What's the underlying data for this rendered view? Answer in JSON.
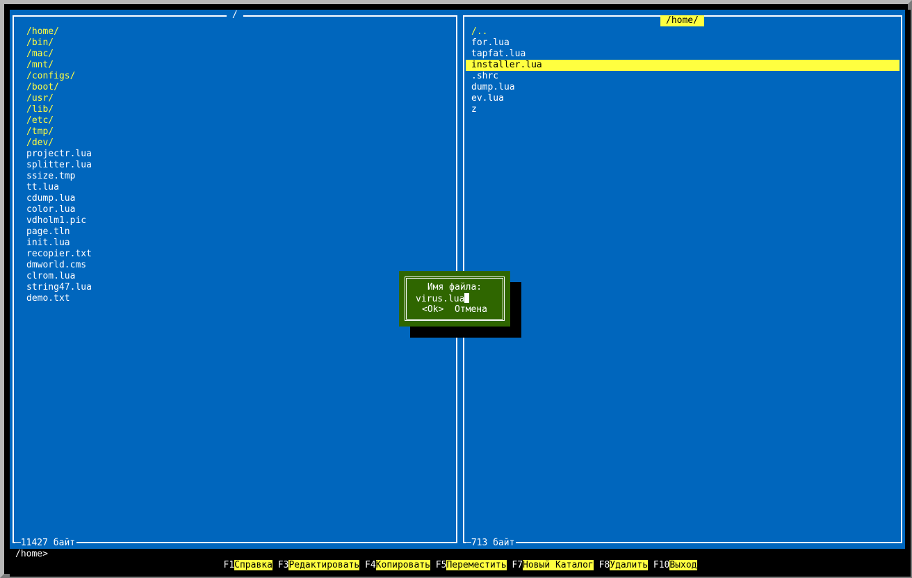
{
  "left_panel": {
    "title": "/",
    "items": [
      {
        "name": "/home/",
        "type": "dir"
      },
      {
        "name": "/bin/",
        "type": "dir"
      },
      {
        "name": "/mac/",
        "type": "dir"
      },
      {
        "name": "/mnt/",
        "type": "dir"
      },
      {
        "name": "/configs/",
        "type": "dir"
      },
      {
        "name": "/boot/",
        "type": "dir"
      },
      {
        "name": "/usr/",
        "type": "dir"
      },
      {
        "name": "/lib/",
        "type": "dir"
      },
      {
        "name": "/etc/",
        "type": "dir"
      },
      {
        "name": "/tmp/",
        "type": "dir"
      },
      {
        "name": "/dev/",
        "type": "dir"
      },
      {
        "name": "projectr.lua",
        "type": "file"
      },
      {
        "name": "splitter.lua",
        "type": "file"
      },
      {
        "name": "ssize.tmp",
        "type": "file"
      },
      {
        "name": "tt.lua",
        "type": "file"
      },
      {
        "name": "cdump.lua",
        "type": "file"
      },
      {
        "name": "color.lua",
        "type": "file"
      },
      {
        "name": "vdholm1.pic",
        "type": "file"
      },
      {
        "name": "page.tln",
        "type": "file"
      },
      {
        "name": "init.lua",
        "type": "file"
      },
      {
        "name": "recopier.txt",
        "type": "file"
      },
      {
        "name": "dmworld.cms",
        "type": "file"
      },
      {
        "name": "clrom.lua",
        "type": "file"
      },
      {
        "name": "string47.lua",
        "type": "file"
      },
      {
        "name": "demo.txt",
        "type": "file"
      }
    ],
    "size_label": "11427 байт"
  },
  "right_panel": {
    "title": "/home/",
    "items": [
      {
        "name": "/..",
        "type": "dir"
      },
      {
        "name": "for.lua",
        "type": "file"
      },
      {
        "name": "tapfat.lua",
        "type": "file"
      },
      {
        "name": "installer.lua",
        "type": "file",
        "selected": true
      },
      {
        "name": ".shrc",
        "type": "file"
      },
      {
        "name": "dump.lua",
        "type": "file"
      },
      {
        "name": "ev.lua",
        "type": "file"
      },
      {
        "name": "z",
        "type": "file"
      }
    ],
    "size_label": "713 байт"
  },
  "prompt": "/home>",
  "fkeys": [
    {
      "key": "F1",
      "label": "Справка"
    },
    {
      "key": "F3",
      "label": "Редактировать"
    },
    {
      "key": "F4",
      "label": "Копировать"
    },
    {
      "key": "F5",
      "label": "Переместить"
    },
    {
      "key": "F7",
      "label": "Новый Каталог"
    },
    {
      "key": "F8",
      "label": "Удалить"
    },
    {
      "key": "F10",
      "label": "Выход"
    }
  ],
  "dialog": {
    "title": "Имя файла:",
    "input_value": "virus.lua",
    "ok_label": "<Ok>",
    "cancel_label": "Отмена"
  },
  "colors": {
    "panel_bg": "#0066bd",
    "dir_text": "#ffff40",
    "highlight": "#ffff40",
    "dialog_bg": "#2f6600"
  }
}
